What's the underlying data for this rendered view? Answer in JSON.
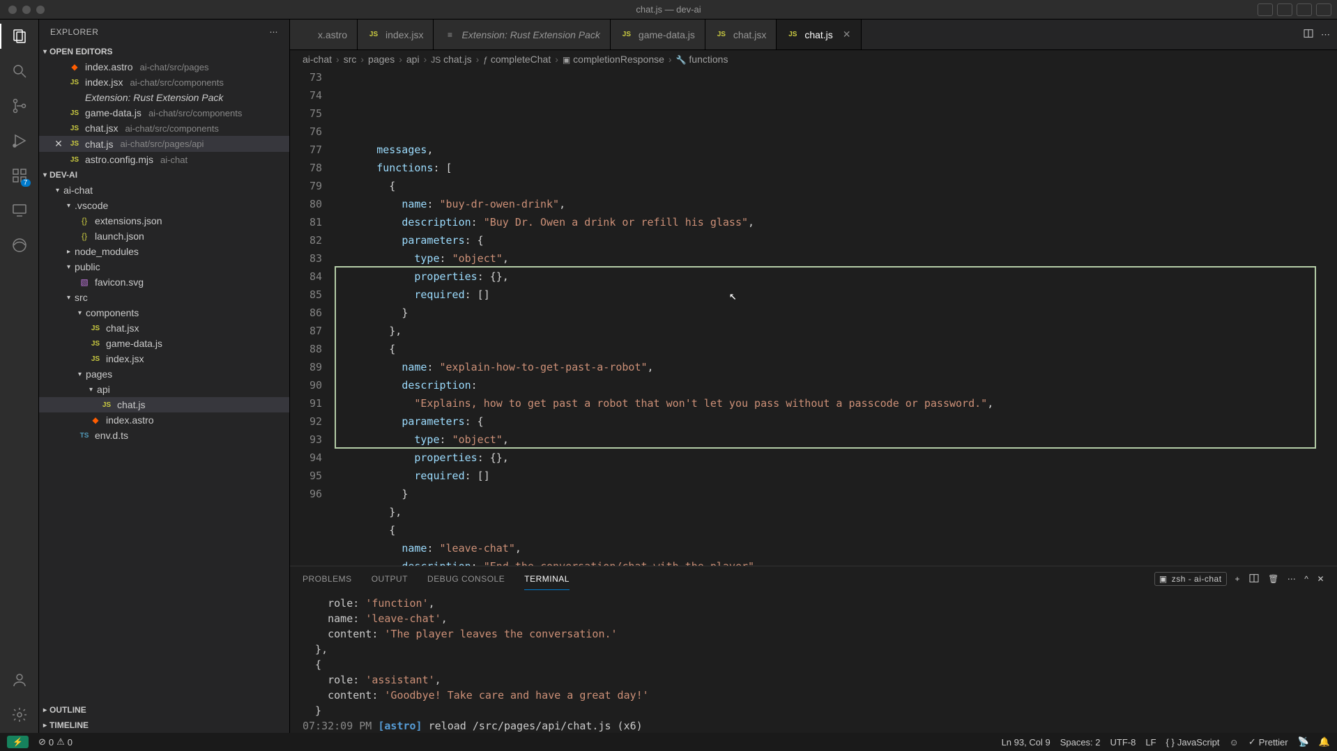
{
  "window": {
    "title": "chat.js — dev-ai"
  },
  "activity": {
    "badge": "7"
  },
  "sidebar": {
    "title": "EXPLORER",
    "sections": {
      "openEditors": "OPEN EDITORS",
      "project": "DEV-AI",
      "outline": "OUTLINE",
      "timeline": "TIMELINE"
    },
    "openEditors": [
      {
        "name": "index.astro",
        "meta": "ai-chat/src/pages",
        "iconClass": "fi-astro",
        "iconText": "◆"
      },
      {
        "name": "index.jsx",
        "meta": "ai-chat/src/components",
        "iconClass": "fi-js",
        "iconText": "JS"
      },
      {
        "name": "Extension: Rust Extension Pack",
        "meta": "",
        "iconClass": "",
        "iconText": "",
        "italic": true
      },
      {
        "name": "game-data.js",
        "meta": "ai-chat/src/components",
        "iconClass": "fi-js",
        "iconText": "JS"
      },
      {
        "name": "chat.jsx",
        "meta": "ai-chat/src/components",
        "iconClass": "fi-js",
        "iconText": "JS"
      },
      {
        "name": "chat.js",
        "meta": "ai-chat/src/pages/api",
        "iconClass": "fi-js",
        "iconText": "JS",
        "active": true,
        "closeVisible": true
      },
      {
        "name": "astro.config.mjs",
        "meta": "ai-chat",
        "iconClass": "fi-mjs",
        "iconText": "JS"
      }
    ],
    "tree": [
      {
        "name": "ai-chat",
        "depth": 1,
        "folder": true,
        "open": true
      },
      {
        "name": ".vscode",
        "depth": 2,
        "folder": true,
        "open": true
      },
      {
        "name": "extensions.json",
        "depth": 3,
        "iconClass": "fi-json",
        "iconText": "{}"
      },
      {
        "name": "launch.json",
        "depth": 3,
        "iconClass": "fi-json",
        "iconText": "{}"
      },
      {
        "name": "node_modules",
        "depth": 2,
        "folder": true,
        "open": false
      },
      {
        "name": "public",
        "depth": 2,
        "folder": true,
        "open": true
      },
      {
        "name": "favicon.svg",
        "depth": 3,
        "iconClass": "fi-svg",
        "iconText": "▧"
      },
      {
        "name": "src",
        "depth": 2,
        "folder": true,
        "open": true
      },
      {
        "name": "components",
        "depth": 3,
        "folder": true,
        "open": true
      },
      {
        "name": "chat.jsx",
        "depth": 4,
        "iconClass": "fi-js",
        "iconText": "JS"
      },
      {
        "name": "game-data.js",
        "depth": 4,
        "iconClass": "fi-js",
        "iconText": "JS"
      },
      {
        "name": "index.jsx",
        "depth": 4,
        "iconClass": "fi-js",
        "iconText": "JS"
      },
      {
        "name": "pages",
        "depth": 3,
        "folder": true,
        "open": true
      },
      {
        "name": "api",
        "depth": 4,
        "folder": true,
        "open": true
      },
      {
        "name": "chat.js",
        "depth": 5,
        "iconClass": "fi-js",
        "iconText": "JS",
        "active": true
      },
      {
        "name": "index.astro",
        "depth": 4,
        "iconClass": "fi-astro",
        "iconText": "◆"
      },
      {
        "name": "env.d.ts",
        "depth": 3,
        "iconClass": "fi-ts",
        "iconText": "TS"
      }
    ]
  },
  "tabs": [
    {
      "label": "x.astro",
      "iconClass": "fi-astro",
      "iconText": ""
    },
    {
      "label": "index.jsx",
      "iconClass": "fi-js",
      "iconText": "JS"
    },
    {
      "label": "Extension: Rust Extension Pack",
      "iconClass": "",
      "iconText": "≡",
      "italic": true
    },
    {
      "label": "game-data.js",
      "iconClass": "fi-js",
      "iconText": "JS"
    },
    {
      "label": "chat.jsx",
      "iconClass": "fi-js",
      "iconText": "JS"
    },
    {
      "label": "chat.js",
      "iconClass": "fi-js",
      "iconText": "JS",
      "active": true,
      "close": true
    }
  ],
  "breadcrumbs": [
    {
      "text": "ai-chat"
    },
    {
      "text": "src"
    },
    {
      "text": "pages"
    },
    {
      "text": "api"
    },
    {
      "text": "chat.js",
      "icon": "JS"
    },
    {
      "text": "completeChat",
      "icon": "ƒ"
    },
    {
      "text": "completionResponse",
      "icon": "▣"
    },
    {
      "text": "functions",
      "icon": "🔧"
    }
  ],
  "code": {
    "startLine": 73,
    "lines": [
      {
        "n": 73,
        "indent": 3,
        "tokens": [
          [
            "prop",
            "messages"
          ],
          [
            "punc",
            ","
          ]
        ]
      },
      {
        "n": 74,
        "indent": 3,
        "tokens": [
          [
            "prop",
            "functions"
          ],
          [
            "punc",
            ": ["
          ]
        ]
      },
      {
        "n": 75,
        "indent": 4,
        "tokens": [
          [
            "punc",
            "{"
          ]
        ]
      },
      {
        "n": 76,
        "indent": 5,
        "tokens": [
          [
            "prop",
            "name"
          ],
          [
            "punc",
            ": "
          ],
          [
            "str",
            "\"buy-dr-owen-drink\""
          ],
          [
            "punc",
            ","
          ]
        ]
      },
      {
        "n": 77,
        "indent": 5,
        "tokens": [
          [
            "prop",
            "description"
          ],
          [
            "punc",
            ": "
          ],
          [
            "str",
            "\"Buy Dr. Owen a drink or refill his glass\""
          ],
          [
            "punc",
            ","
          ]
        ]
      },
      {
        "n": 78,
        "indent": 5,
        "tokens": [
          [
            "prop",
            "parameters"
          ],
          [
            "punc",
            ": {"
          ]
        ]
      },
      {
        "n": 79,
        "indent": 6,
        "tokens": [
          [
            "prop",
            "type"
          ],
          [
            "punc",
            ": "
          ],
          [
            "str",
            "\"object\""
          ],
          [
            "punc",
            ","
          ]
        ]
      },
      {
        "n": 80,
        "indent": 6,
        "tokens": [
          [
            "prop",
            "properties"
          ],
          [
            "punc",
            ": {},"
          ]
        ]
      },
      {
        "n": 81,
        "indent": 6,
        "tokens": [
          [
            "prop",
            "required"
          ],
          [
            "punc",
            ": []"
          ]
        ]
      },
      {
        "n": 82,
        "indent": 5,
        "tokens": [
          [
            "punc",
            "}"
          ]
        ]
      },
      {
        "n": 83,
        "indent": 4,
        "tokens": [
          [
            "punc",
            "},"
          ]
        ]
      },
      {
        "n": 84,
        "indent": 4,
        "tokens": [
          [
            "punc",
            "{"
          ]
        ]
      },
      {
        "n": 85,
        "indent": 5,
        "tokens": [
          [
            "prop",
            "name"
          ],
          [
            "punc",
            ": "
          ],
          [
            "str",
            "\"explain-how-to-get-past-a-robot\""
          ],
          [
            "punc",
            ","
          ]
        ]
      },
      {
        "n": 86,
        "indent": 5,
        "tokens": [
          [
            "prop",
            "description"
          ],
          [
            "punc",
            ":"
          ]
        ]
      },
      {
        "n": 87,
        "indent": 6,
        "tokens": [
          [
            "str",
            "\"Explains, how to get past a robot that won't let you pass without a passcode or password.\""
          ],
          [
            "punc",
            ","
          ]
        ]
      },
      {
        "n": 88,
        "indent": 5,
        "tokens": [
          [
            "prop",
            "parameters"
          ],
          [
            "punc",
            ": {"
          ]
        ]
      },
      {
        "n": 89,
        "indent": 6,
        "tokens": [
          [
            "prop",
            "type"
          ],
          [
            "punc",
            ": "
          ],
          [
            "str",
            "\"object\""
          ],
          [
            "punc",
            ","
          ]
        ]
      },
      {
        "n": 90,
        "indent": 6,
        "tokens": [
          [
            "prop",
            "properties"
          ],
          [
            "punc",
            ": {},"
          ]
        ]
      },
      {
        "n": 91,
        "indent": 6,
        "tokens": [
          [
            "prop",
            "required"
          ],
          [
            "punc",
            ": []"
          ]
        ]
      },
      {
        "n": 92,
        "indent": 5,
        "tokens": [
          [
            "punc",
            "}"
          ]
        ]
      },
      {
        "n": 93,
        "indent": 4,
        "tokens": [
          [
            "punc",
            "},"
          ]
        ]
      },
      {
        "n": 94,
        "indent": 4,
        "tokens": [
          [
            "punc",
            "{"
          ]
        ]
      },
      {
        "n": 95,
        "indent": 5,
        "tokens": [
          [
            "prop",
            "name"
          ],
          [
            "punc",
            ": "
          ],
          [
            "str",
            "\"leave-chat\""
          ],
          [
            "punc",
            ","
          ]
        ]
      },
      {
        "n": 96,
        "indent": 5,
        "tokens": [
          [
            "prop",
            "description"
          ],
          [
            "punc",
            ": "
          ],
          [
            "str",
            "\"End the conversation/chat with the player\""
          ],
          [
            "punc",
            ","
          ]
        ]
      }
    ],
    "highlight": {
      "startLine": 84,
      "endLine": 93
    }
  },
  "panel": {
    "tabs": {
      "problems": "PROBLEMS",
      "output": "OUTPUT",
      "debug": "DEBUG CONSOLE",
      "terminal": "TERMINAL"
    },
    "terminalLabel": "zsh - ai-chat",
    "terminal": [
      "    role: 'function',",
      "    name: 'leave-chat',",
      "    content: 'The player leaves the conversation.'",
      "  },",
      "  {",
      "    role: 'assistant',",
      "    content: 'Goodbye! Take care and have a great day!'",
      "  }",
      "07:32:09 PM [astro] reload /src/pages/api/chat.js (x6)",
      "▯"
    ]
  },
  "status": {
    "remote": "⎇",
    "errors": "0",
    "warnings": "0",
    "position": "Ln 93, Col 9",
    "spaces": "Spaces: 2",
    "encoding": "UTF-8",
    "eol": "LF",
    "lang": "JavaScript",
    "prettier": "Prettier"
  }
}
